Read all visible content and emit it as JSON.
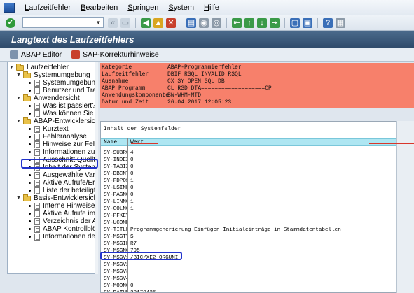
{
  "menubar": {
    "items": [
      "Laufzeitfehler",
      "Bearbeiten",
      "Springen",
      "System",
      "Hilfe"
    ]
  },
  "toolbar": {
    "command_value": ""
  },
  "title": {
    "text": "Langtext des Laufzeitfehlers"
  },
  "app_toolbar": {
    "abap_editor": "ABAP Editor",
    "sap_notes": "SAP-Korrekturhinweise"
  },
  "tree": {
    "root": "Laufzeitfehler",
    "nodes": [
      {
        "label": "Systemumgebung",
        "type": "folder"
      },
      {
        "label": "Systemumgebung",
        "type": "doc"
      },
      {
        "label": "Benutzer und Transaktion",
        "type": "doc"
      },
      {
        "label": "Anwendersicht",
        "type": "folder"
      },
      {
        "label": "Was ist passiert?",
        "type": "doc"
      },
      {
        "label": "Was können Sie tun?",
        "type": "doc"
      },
      {
        "label": "ABAP-Entwicklersicht",
        "type": "folder"
      },
      {
        "label": "Kurztext",
        "type": "doc"
      },
      {
        "label": "Fehleranalyse",
        "type": "doc"
      },
      {
        "label": "Hinweise zur Fehlerbehebung",
        "type": "doc"
      },
      {
        "label": "Informationen zur Abbruchstelle",
        "type": "doc"
      },
      {
        "label": "Ausschnitt Quelltext",
        "type": "doc"
      },
      {
        "label": "Inhalt der Systemfelder",
        "type": "doc"
      },
      {
        "label": "Ausgewählte Variablen",
        "type": "doc"
      },
      {
        "label": "Aktive Aufrufe/Ereignisse",
        "type": "doc"
      },
      {
        "label": "Liste der beteiligten ABAP",
        "type": "doc"
      },
      {
        "label": "Basis-Entwicklersicht",
        "type": "folder"
      },
      {
        "label": "Interne Hinweise",
        "type": "doc"
      },
      {
        "label": "Aktive Aufrufe im SAP Kernel",
        "type": "doc"
      },
      {
        "label": "Verzeichnis der Anwendungstabellen",
        "type": "doc"
      },
      {
        "label": "ABAP Kontrollblöcke (CONT)",
        "type": "doc"
      },
      {
        "label": "Informationen den Speicher",
        "type": "doc"
      }
    ]
  },
  "info": [
    {
      "key": "Kategorie",
      "value": "ABAP-Programmierfehler"
    },
    {
      "key": "Laufzeitfehler",
      "value": "DBIF_RSQL_INVALID_RSQL"
    },
    {
      "key": "Ausnahme",
      "value": "CX_SY_OPEN_SQL_DB"
    },
    {
      "key": "ABAP Programm",
      "value": "CL_RSD_DTA===================CP"
    },
    {
      "key": "Anwendungskomponente",
      "value": "BW-WHM-MTD"
    },
    {
      "key": "Datum und Zeit",
      "value": "26.04.2017 12:05:23"
    }
  ],
  "systemfields": {
    "title": "Inhalt der Systemfelder",
    "col_name": "Name",
    "col_value": "Wert",
    "rows": [
      {
        "name": "SY-SUBRC",
        "value": "4"
      },
      {
        "name": "SY-INDEX",
        "value": "0"
      },
      {
        "name": "SY-TABIX",
        "value": "0"
      },
      {
        "name": "SY-DBCNT",
        "value": "0"
      },
      {
        "name": "SY-FDPOS",
        "value": "1"
      },
      {
        "name": "SY-LSIND",
        "value": "0"
      },
      {
        "name": "SY-PAGNO",
        "value": "0"
      },
      {
        "name": "SY-LINNO",
        "value": "1"
      },
      {
        "name": "SY-COLNO",
        "value": "1"
      },
      {
        "name": "SY-PFKEY",
        "value": ""
      },
      {
        "name": "SY-UCOMM",
        "value": ""
      },
      {
        "name": "SY-TITLE",
        "value": "Programmgenerierung Einfügen Initialeinträge in Stammdatentabellen"
      },
      {
        "name": "SY-MSGTY",
        "value": "S"
      },
      {
        "name": "SY-MSGID",
        "value": "R7"
      },
      {
        "name": "SY-MSGNO",
        "value": "795"
      },
      {
        "name": "SY-MSGV1",
        "value": "/BIC/XE2_ORGUNI"
      },
      {
        "name": "SY-MSGV2",
        "value": ""
      },
      {
        "name": "SY-MSGV3",
        "value": ""
      },
      {
        "name": "SY-MSGV4",
        "value": ""
      },
      {
        "name": "SY-MODNO",
        "value": "0"
      },
      {
        "name": "SY-DATUM",
        "value": "20170426"
      }
    ]
  }
}
